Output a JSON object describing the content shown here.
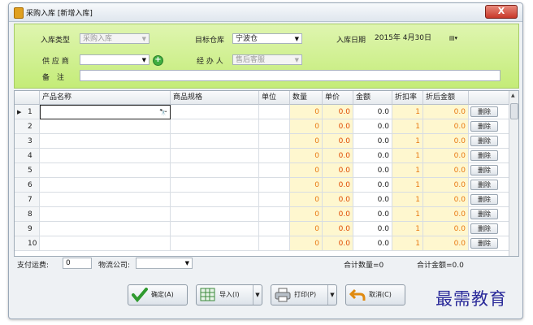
{
  "window": {
    "title": "采购入库 [新增入库]",
    "close_label": "X"
  },
  "header": {
    "type_label": "入库类型",
    "type_value": "采购入库",
    "warehouse_label": "目标仓库",
    "warehouse_value": "宁波仓",
    "date_label": "入库日期",
    "date_value": "2015年 4月30日",
    "supplier_label": "供 应 商",
    "supplier_value": "",
    "handler_label": "经 办 人",
    "handler_value": "售后客服",
    "remark_label": "备　注",
    "remark_value": ""
  },
  "grid": {
    "columns": [
      "产品名称",
      "商品规格",
      "单位",
      "数量",
      "单价",
      "金额",
      "折扣率",
      "折后金额"
    ],
    "rows": [
      {
        "no": "1",
        "qty": "0",
        "price": "0.0",
        "amount": "0.0",
        "discount": "1",
        "final": "0.0",
        "del": "删除"
      },
      {
        "no": "2",
        "qty": "0",
        "price": "0.0",
        "amount": "0.0",
        "discount": "1",
        "final": "0.0",
        "del": "删除"
      },
      {
        "no": "3",
        "qty": "0",
        "price": "0.0",
        "amount": "0.0",
        "discount": "1",
        "final": "0.0",
        "del": "删除"
      },
      {
        "no": "4",
        "qty": "0",
        "price": "0.0",
        "amount": "0.0",
        "discount": "1",
        "final": "0.0",
        "del": "删除"
      },
      {
        "no": "5",
        "qty": "0",
        "price": "0.0",
        "amount": "0.0",
        "discount": "1",
        "final": "0.0",
        "del": "删除"
      },
      {
        "no": "6",
        "qty": "0",
        "price": "0.0",
        "amount": "0.0",
        "discount": "1",
        "final": "0.0",
        "del": "删除"
      },
      {
        "no": "7",
        "qty": "0",
        "price": "0.0",
        "amount": "0.0",
        "discount": "1",
        "final": "0.0",
        "del": "删除"
      },
      {
        "no": "8",
        "qty": "0",
        "price": "0.0",
        "amount": "0.0",
        "discount": "1",
        "final": "0.0",
        "del": "删除"
      },
      {
        "no": "9",
        "qty": "0",
        "price": "0.0",
        "amount": "0.0",
        "discount": "1",
        "final": "0.0",
        "del": "删除"
      },
      {
        "no": "10",
        "qty": "0",
        "price": "0.0",
        "amount": "0.0",
        "discount": "1",
        "final": "0.0",
        "del": "删除"
      }
    ]
  },
  "footer": {
    "freight_label": "支付运费:",
    "freight_value": "0",
    "logistics_label": "物流公司:",
    "logistics_value": "",
    "total_qty": "合计数量=0",
    "total_amount": "合计金额=0.0"
  },
  "buttons": {
    "confirm": "确定(A)",
    "import": "导入(I)",
    "print": "打印(P)",
    "cancel": "取消(C)"
  },
  "watermark": "最需教育",
  "icons": [
    "folder-icon",
    "close-icon",
    "dropdown-arrow-icon",
    "calendar-icon",
    "add-icon",
    "binoculars-icon",
    "checkmark-icon",
    "spreadsheet-icon",
    "printer-icon",
    "undo-arrow-icon"
  ],
  "colors": {
    "header_green": "#c4ec78",
    "yellow_cell": "#fef7cf",
    "orange_text": "#e87810"
  }
}
